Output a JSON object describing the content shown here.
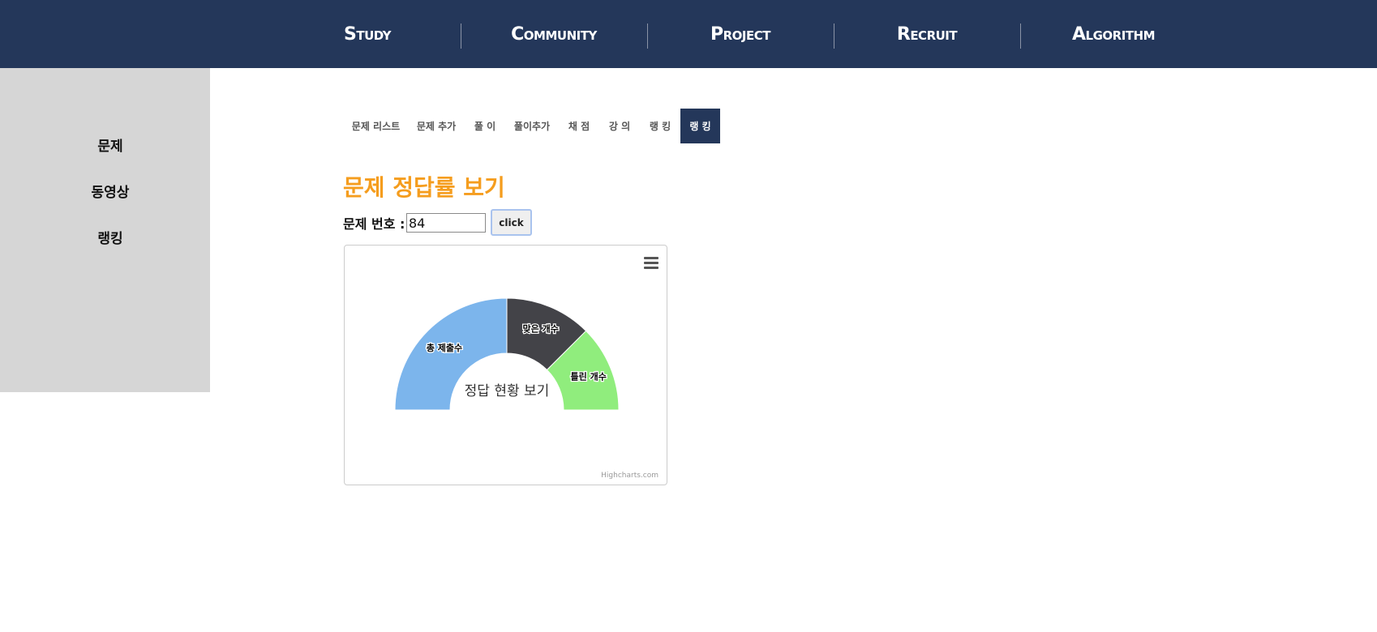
{
  "nav": {
    "items": [
      {
        "label": "Study"
      },
      {
        "label": "Community"
      },
      {
        "label": "Project"
      },
      {
        "label": "Recruit"
      },
      {
        "label": "Algorithm"
      }
    ]
  },
  "sidebar": {
    "items": [
      {
        "label": "문제"
      },
      {
        "label": "동영상"
      },
      {
        "label": "랭킹"
      }
    ]
  },
  "subtabs": {
    "items": [
      {
        "label": "문제 리스트"
      },
      {
        "label": "문제 추가"
      },
      {
        "label": "풀 이"
      },
      {
        "label": "풀이추가"
      },
      {
        "label": "채 점"
      },
      {
        "label": "강 의"
      },
      {
        "label": "랭 킹"
      },
      {
        "label": "랭 킹"
      }
    ],
    "active_index": 7
  },
  "main": {
    "heading": "문제 정답률 보기",
    "problem_label": "문제 번호 :",
    "problem_value": "84",
    "click_label": "click"
  },
  "chart_data": {
    "type": "pie",
    "title": "정답 현황 보기",
    "series": [
      {
        "name": "총 제출수",
        "value": 50,
        "color": "#7cb5ec"
      },
      {
        "name": "맞은 개수",
        "value": 25,
        "color": "#434348"
      },
      {
        "name": "틀린 개수",
        "value": 25,
        "color": "#90ed7d"
      }
    ],
    "credits": "Highcharts.com",
    "menu_icon": "hamburger-menu-icon"
  }
}
